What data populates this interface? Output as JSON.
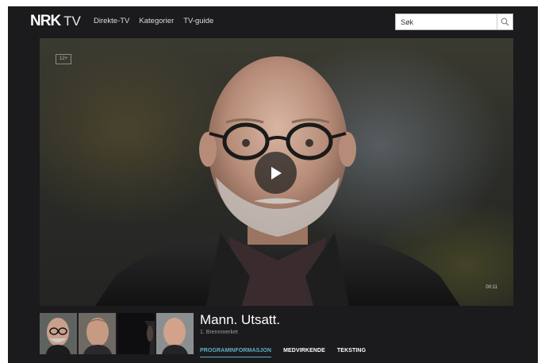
{
  "header": {
    "logo_main": "NRK",
    "logo_suffix": "TV",
    "nav": [
      "Direkte-TV",
      "Kategorier",
      "TV-guide"
    ],
    "search_placeholder": "Søk",
    "search_icon": "magnifier-icon"
  },
  "player": {
    "age_rating": "12+",
    "duration": "00:11",
    "play_icon": "play-icon"
  },
  "program": {
    "title": "Mann. Utsatt.",
    "episode": "1. Brennmerket",
    "tabs": [
      {
        "label": "PROGRAMINFORMASJON",
        "active": true
      },
      {
        "label": "MEDVIRKENDE",
        "active": false
      },
      {
        "label": "TEKSTING",
        "active": false
      }
    ]
  },
  "colors": {
    "background": "#1b1b1d",
    "accent": "#5fb1c6"
  }
}
